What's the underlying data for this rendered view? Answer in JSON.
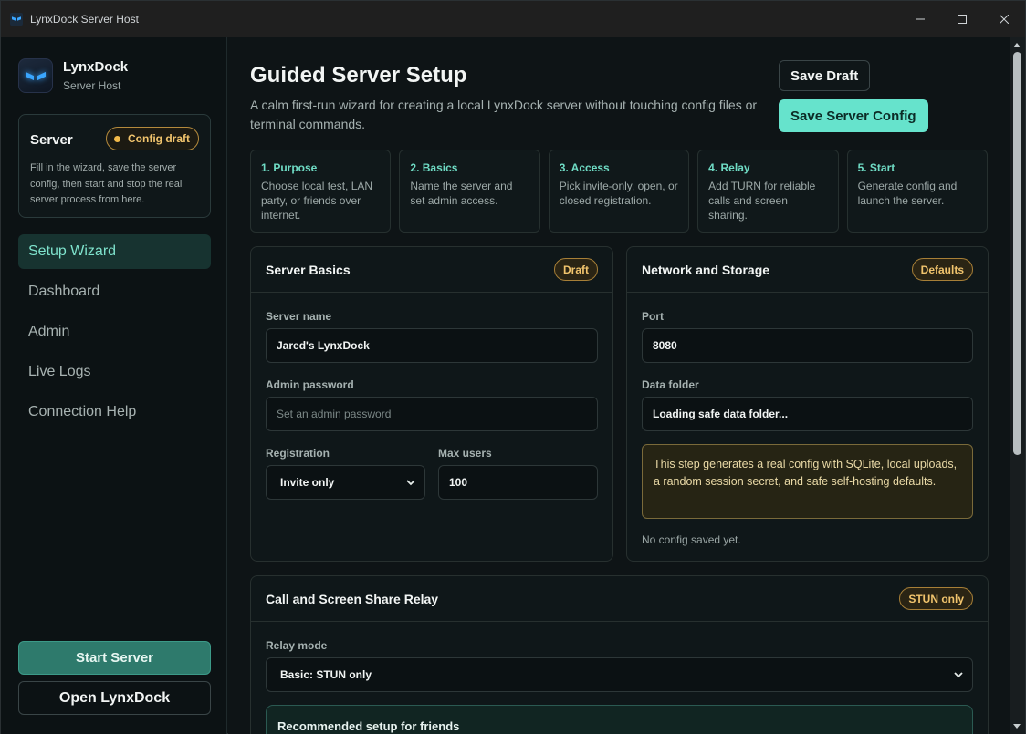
{
  "window": {
    "title": "LynxDock Server Host"
  },
  "brand": {
    "name": "LynxDock",
    "subtitle": "Server Host"
  },
  "server_card": {
    "title": "Server",
    "badge": "Config draft",
    "description": "Fill in the wizard, save the server config, then start and stop the real server process from here."
  },
  "nav": {
    "items": [
      {
        "label": "Setup Wizard",
        "active": true
      },
      {
        "label": "Dashboard"
      },
      {
        "label": "Admin"
      },
      {
        "label": "Live Logs"
      },
      {
        "label": "Connection Help"
      }
    ]
  },
  "sidebar_actions": {
    "start": "Start Server",
    "open": "Open LynxDock"
  },
  "header": {
    "title": "Guided Server Setup",
    "subtitle": "A calm first-run wizard for creating a local LynxDock server without touching config files or terminal commands.",
    "save_draft": "Save Draft",
    "save_config": "Save Server Config"
  },
  "steps": [
    {
      "title": "1. Purpose",
      "desc": "Choose local test, LAN party, or friends over internet."
    },
    {
      "title": "2. Basics",
      "desc": "Name the server and set admin access."
    },
    {
      "title": "3. Access",
      "desc": "Pick invite-only, open, or closed registration."
    },
    {
      "title": "4. Relay",
      "desc": "Add TURN for reliable calls and screen sharing."
    },
    {
      "title": "5. Start",
      "desc": "Generate config and launch the server."
    }
  ],
  "server_basics": {
    "title": "Server Basics",
    "badge": "Draft",
    "name_label": "Server name",
    "name_value": "Jared's LynxDock",
    "password_label": "Admin password",
    "password_placeholder": "Set an admin password",
    "registration_label": "Registration",
    "registration_value": "Invite only",
    "max_users_label": "Max users",
    "max_users_value": "100"
  },
  "network": {
    "title": "Network and Storage",
    "badge": "Defaults",
    "port_label": "Port",
    "port_value": "8080",
    "data_folder_label": "Data folder",
    "data_folder_value": "Loading safe data folder...",
    "note": "This step generates a real config with SQLite, local uploads, a random session secret, and safe self-hosting defaults.",
    "status": "No config saved yet."
  },
  "relay": {
    "title": "Call and Screen Share Relay",
    "badge": "STUN only",
    "mode_label": "Relay mode",
    "mode_value": "Basic: STUN only",
    "recommended_title": "Recommended setup for friends"
  },
  "colors": {
    "accent": "#66e3cc",
    "active_nav_bg": "#173330",
    "warning": "#f1c46d"
  }
}
